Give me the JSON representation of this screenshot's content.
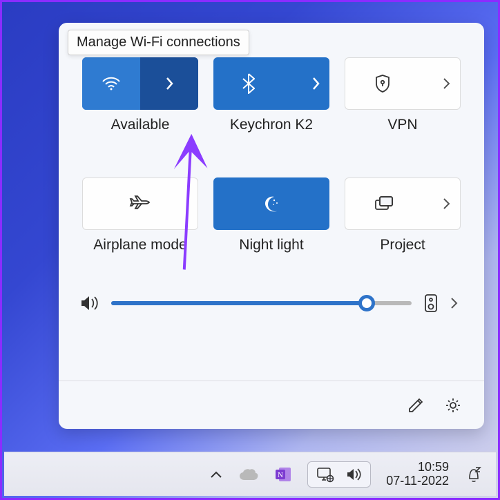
{
  "tooltip": "Manage Wi-Fi connections",
  "tiles": {
    "wifi": {
      "label": "Available"
    },
    "bluetooth": {
      "label": "Keychron K2"
    },
    "vpn": {
      "label": "VPN"
    },
    "airplane": {
      "label": "Airplane mode"
    },
    "night": {
      "label": "Night light"
    },
    "project": {
      "label": "Project"
    }
  },
  "volume": {
    "percent": 85
  },
  "clock": {
    "time": "10:59",
    "date": "07-11-2022"
  },
  "colors": {
    "accent": "#2e73c9",
    "purple": "#8b2cff"
  }
}
